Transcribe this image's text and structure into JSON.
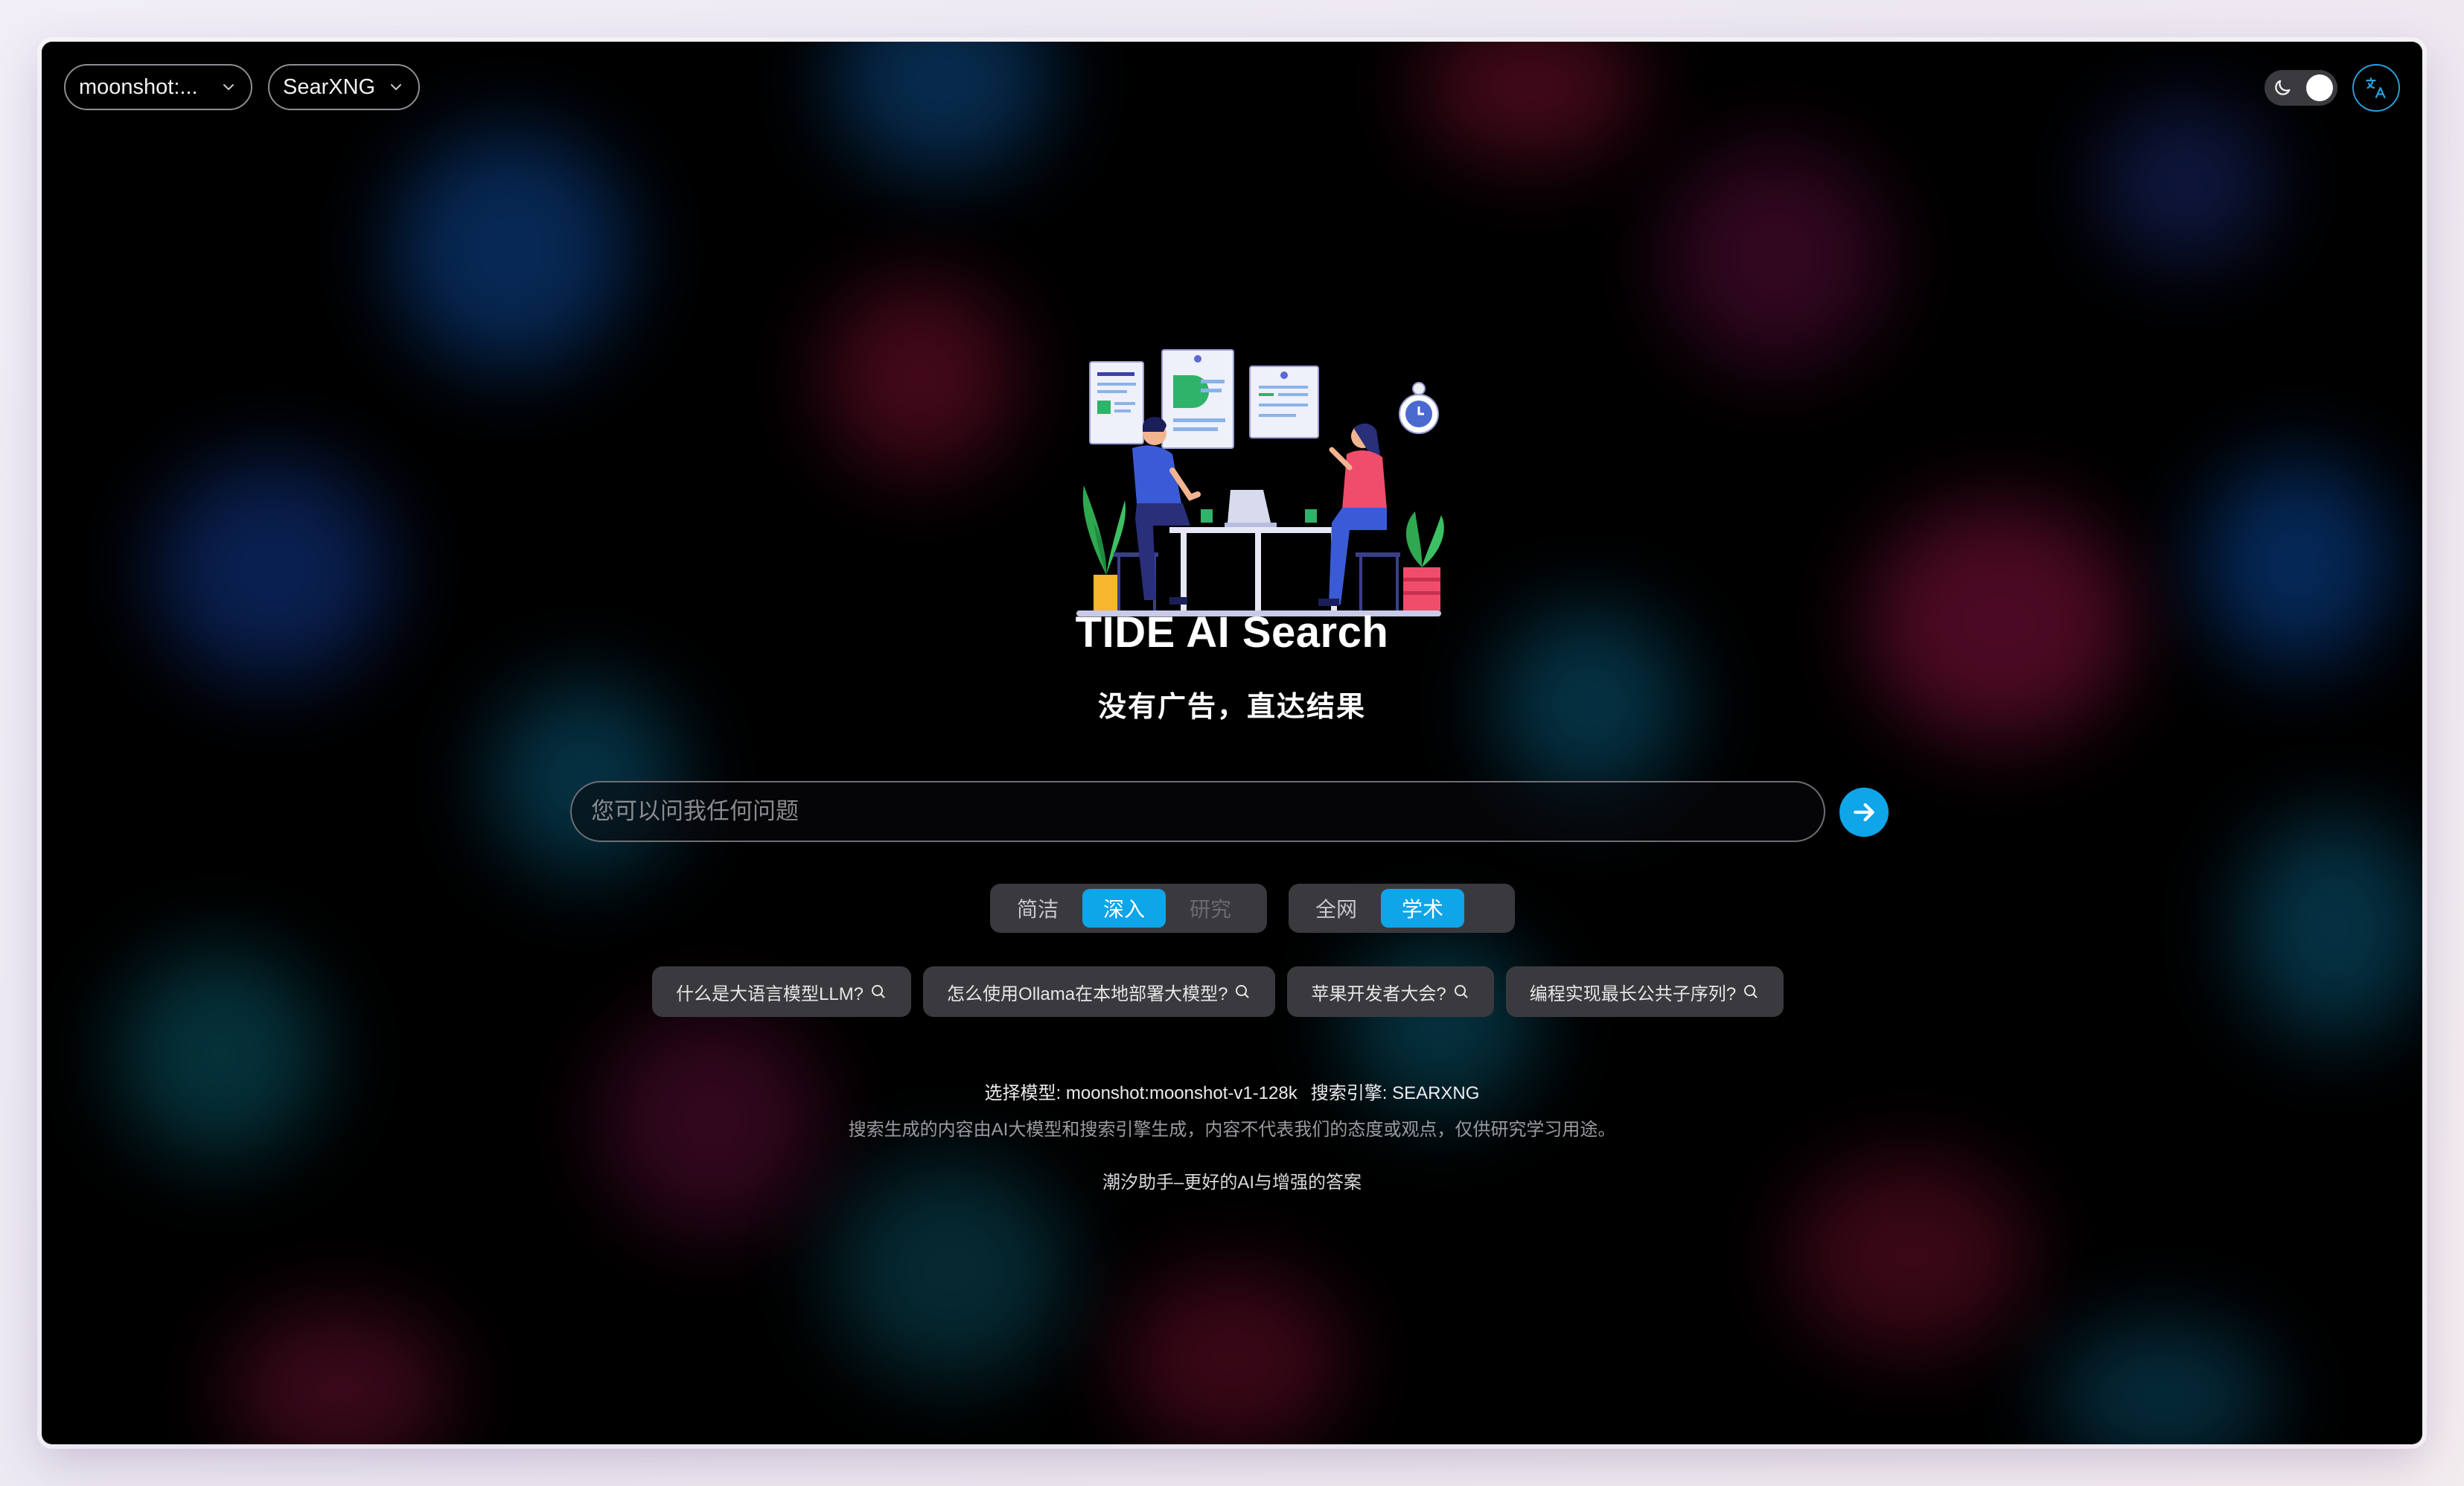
{
  "header": {
    "model_select": {
      "value": "moonshot:..."
    },
    "engine_select": {
      "value": "SearXNG"
    },
    "theme_toggle": {
      "icon": "moon-icon",
      "state": "dark"
    },
    "language_button": {
      "icon": "translate-icon"
    }
  },
  "hero": {
    "title": "TIDE AI Search",
    "subtitle": "没有广告，直达结果"
  },
  "search": {
    "placeholder": "您可以问我任何问题",
    "value": "",
    "submit_icon": "arrow-right-icon"
  },
  "mode_options": [
    {
      "label": "简洁",
      "state": "normal"
    },
    {
      "label": "深入",
      "state": "active"
    },
    {
      "label": "研究",
      "state": "disabled"
    }
  ],
  "scope_options": [
    {
      "label": "全网",
      "state": "normal"
    },
    {
      "label": "学术",
      "state": "active"
    }
  ],
  "suggestions": [
    "什么是大语言模型LLM?",
    "怎么使用Ollama在本地部署大模型?",
    "苹果开发者大会?",
    "编程实现最长公共子序列?"
  ],
  "footer": {
    "model_info": "选择模型: moonshot:moonshot-v1-128k",
    "engine_info": "搜索引擎: SEARXNG",
    "disclaimer": "搜索生成的内容由AI大模型和搜索引擎生成，内容不代表我们的态度或观点，仅供研究学习用途。",
    "tagline": "潮汐助手–更好的AI与增强的答案"
  },
  "colors": {
    "accent": "#0ea5e9",
    "background": "#000000",
    "chip_bg": "#3a3a3e",
    "lang_border": "#2a9fd8"
  }
}
